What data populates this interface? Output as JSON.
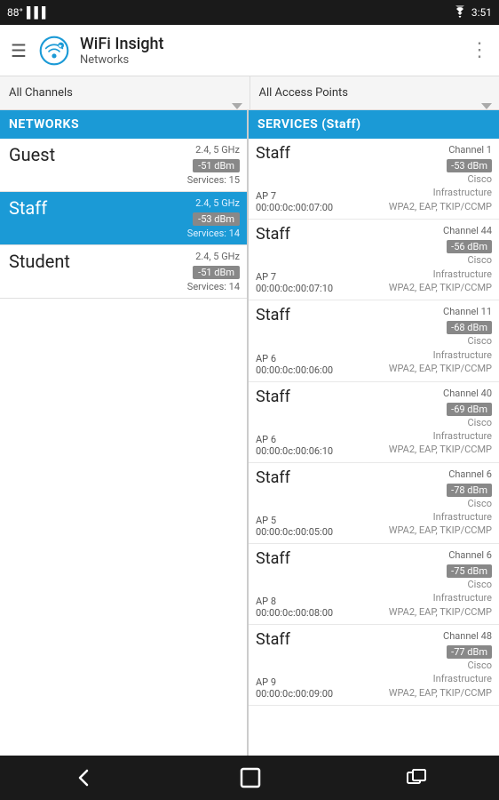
{
  "statusBar": {
    "battery": "88°",
    "signal": "▌▌▌",
    "wifi": "wifi",
    "time": "3:51"
  },
  "appBar": {
    "menuIcon": "☰",
    "title": "WiFi Insight",
    "subtitle": "Networks",
    "moreIcon": "⋮"
  },
  "filters": {
    "channels": "All Channels",
    "accessPoints": "All Access Points"
  },
  "leftPanel": {
    "header": "NETWORKS",
    "networks": [
      {
        "name": "Guest",
        "freq": "2.4, 5 GHz",
        "dbm": "-51 dBm",
        "services": "Services: 15",
        "selected": false
      },
      {
        "name": "Staff",
        "freq": "2.4, 5 GHz",
        "dbm": "-53 dBm",
        "services": "Services: 14",
        "selected": true
      },
      {
        "name": "Student",
        "freq": "2.4, 5 GHz",
        "dbm": "-51 dBm",
        "services": "Services: 14",
        "selected": false
      }
    ]
  },
  "rightPanel": {
    "header": "SERVICES (Staff)",
    "services": [
      {
        "name": "Staff",
        "channel": "Channel 1",
        "dbm": "-53 dBm",
        "ap": "AP 7",
        "mac": "00:00:0c:00:07:00",
        "vendor": "Cisco",
        "type": "Infrastructure",
        "security": "WPA2, EAP, TKIP/CCMP"
      },
      {
        "name": "Staff",
        "channel": "Channel 44",
        "dbm": "-56 dBm",
        "ap": "AP 7",
        "mac": "00:00:0c:00:07:10",
        "vendor": "Cisco",
        "type": "Infrastructure",
        "security": "WPA2, EAP, TKIP/CCMP"
      },
      {
        "name": "Staff",
        "channel": "Channel 11",
        "dbm": "-68 dBm",
        "ap": "AP 6",
        "mac": "00:00:0c:00:06:00",
        "vendor": "Cisco",
        "type": "Infrastructure",
        "security": "WPA2, EAP, TKIP/CCMP"
      },
      {
        "name": "Staff",
        "channel": "Channel 40",
        "dbm": "-69 dBm",
        "ap": "AP 6",
        "mac": "00:00:0c:00:06:10",
        "vendor": "Cisco",
        "type": "Infrastructure",
        "security": "WPA2, EAP, TKIP/CCMP"
      },
      {
        "name": "Staff",
        "channel": "Channel 6",
        "dbm": "-78 dBm",
        "ap": "AP 5",
        "mac": "00:00:0c:00:05:00",
        "vendor": "Cisco",
        "type": "Infrastructure",
        "security": "WPA2, EAP, TKIP/CCMP"
      },
      {
        "name": "Staff",
        "channel": "Channel 6",
        "dbm": "-75 dBm",
        "ap": "AP 8",
        "mac": "00:00:0c:00:08:00",
        "vendor": "Cisco",
        "type": "Infrastructure",
        "security": "WPA2, EAP, TKIP/CCMP"
      },
      {
        "name": "Staff",
        "channel": "Channel 48",
        "dbm": "-77 dBm",
        "ap": "AP 9",
        "mac": "00:00:0c:00:09:00",
        "vendor": "Cisco",
        "type": "Infrastructure",
        "security": "WPA2, EAP, TKIP/CCMP"
      }
    ]
  },
  "navBar": {
    "backIcon": "←",
    "homeIcon": "⬜",
    "recentIcon": "▣"
  }
}
